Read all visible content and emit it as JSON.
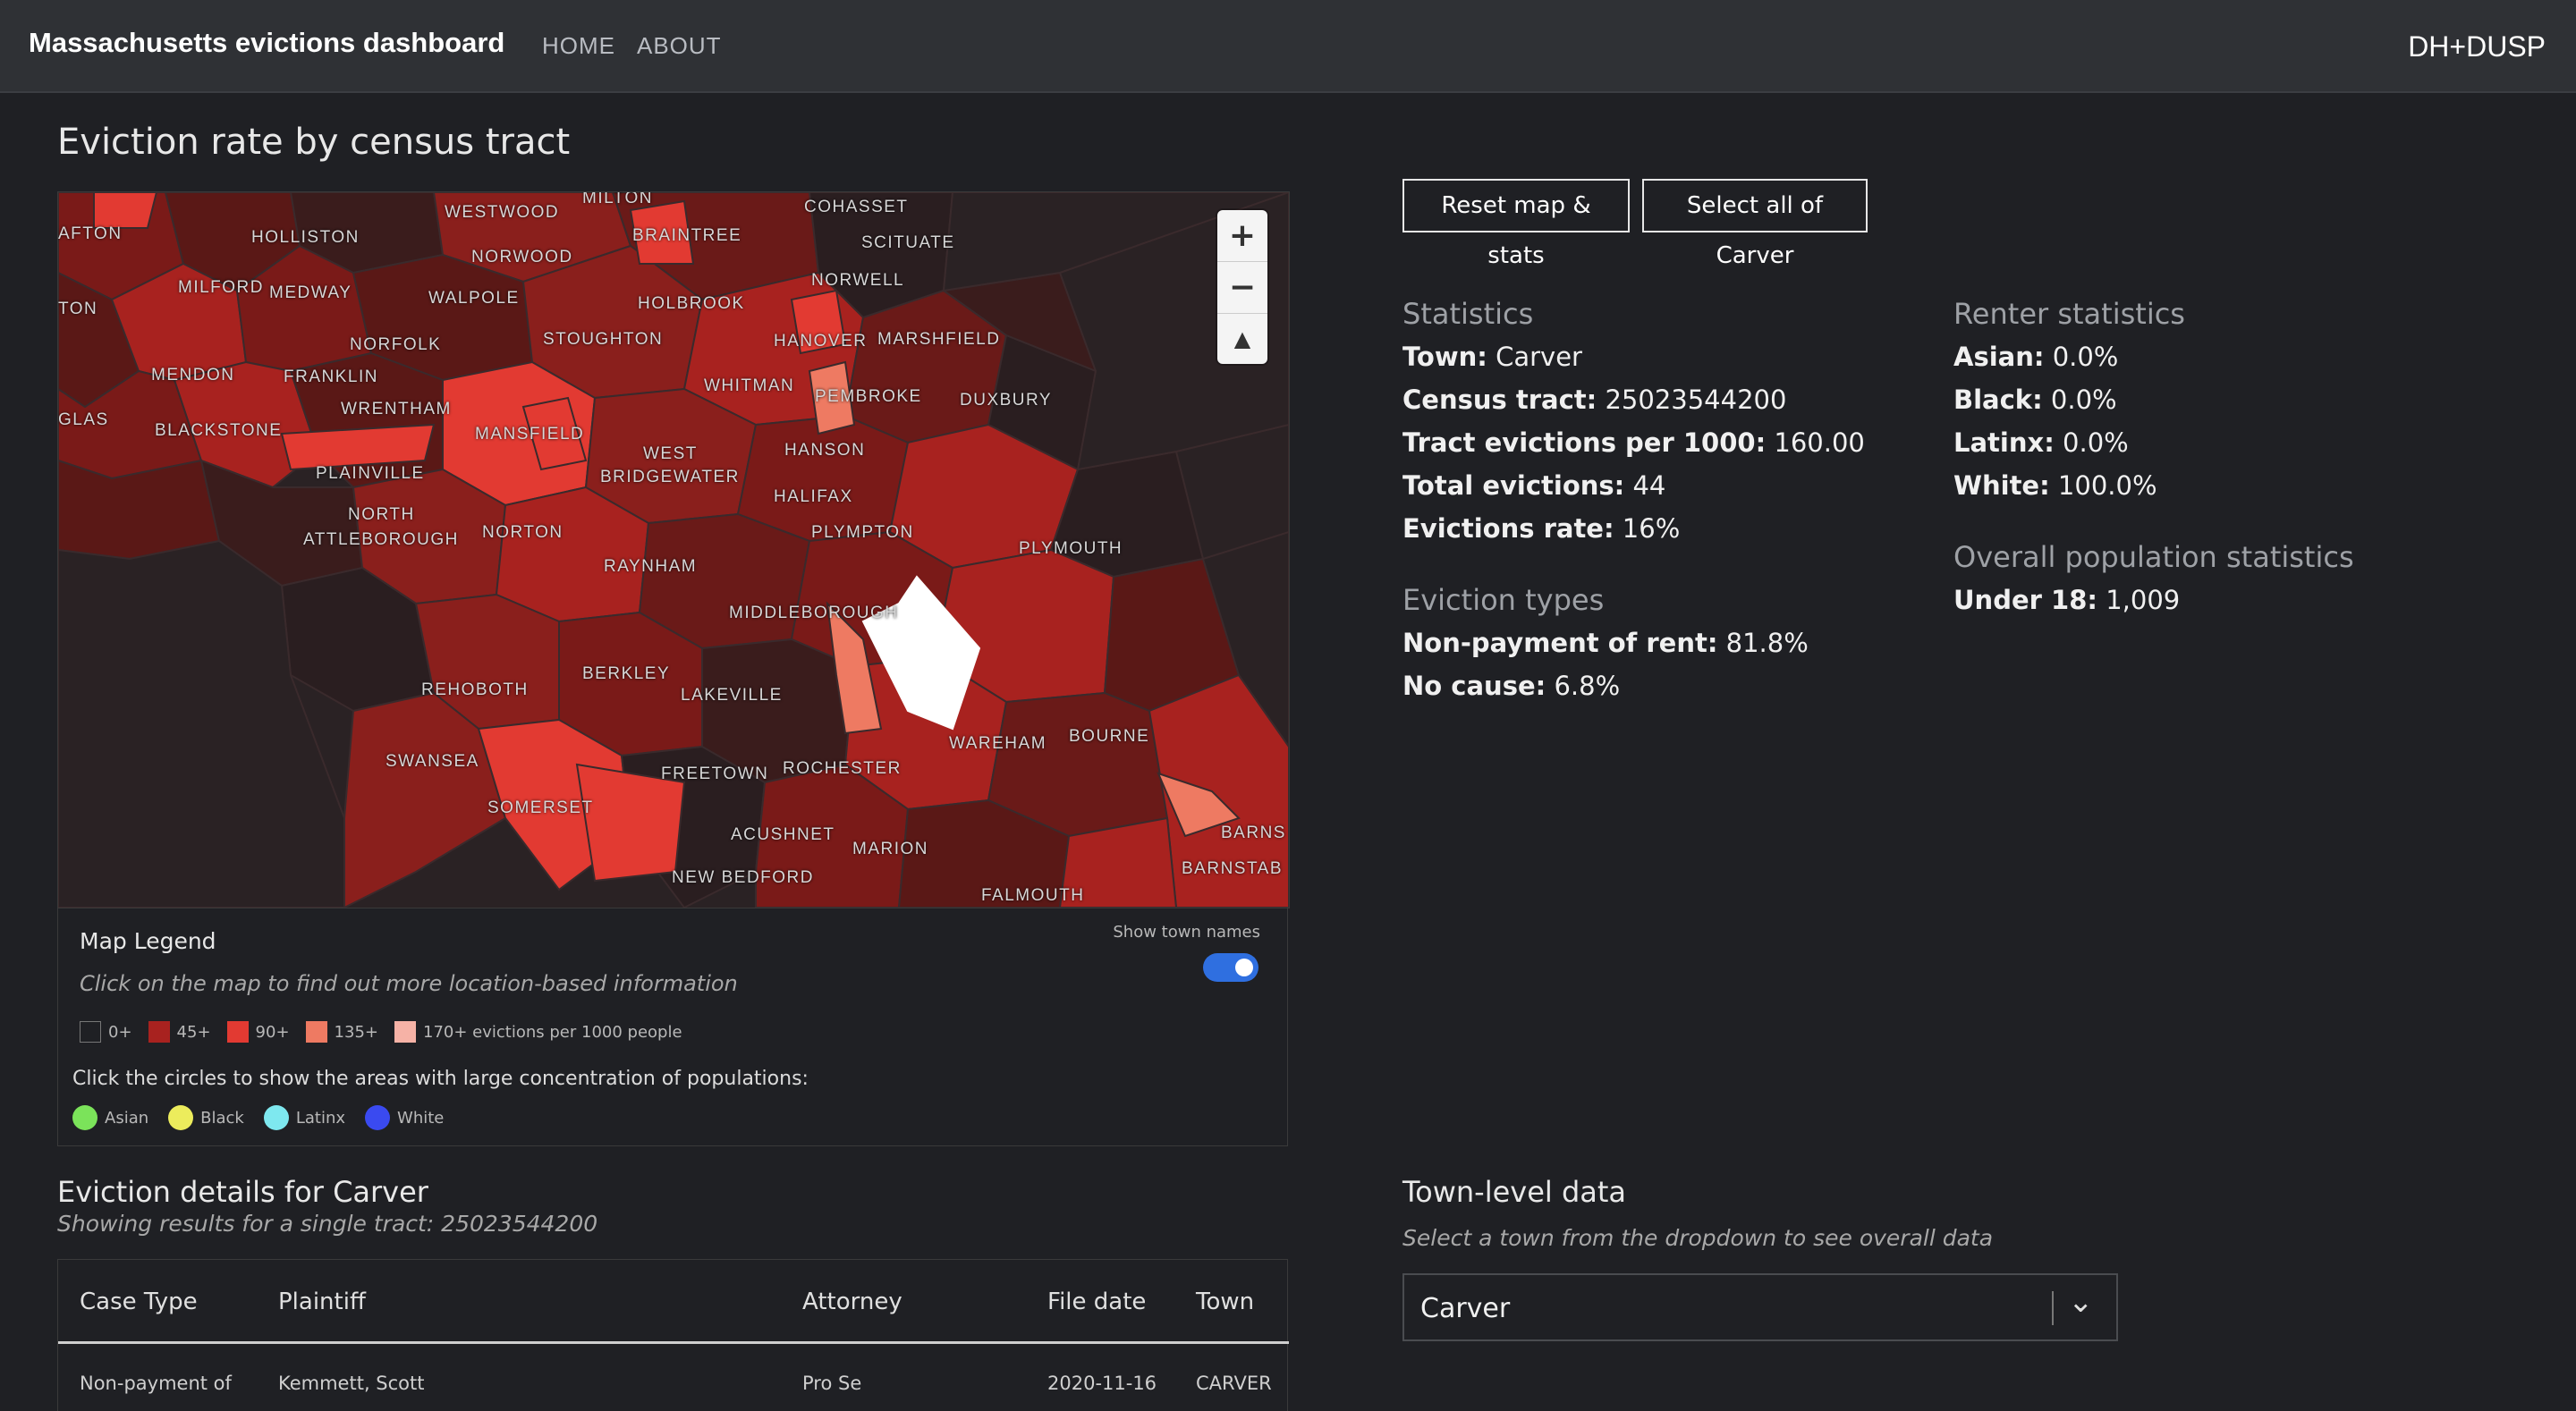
{
  "nav": {
    "brand": "Massachusetts evictions dashboard",
    "links": [
      "HOME",
      "ABOUT"
    ],
    "right": "DH+DUSP"
  },
  "map_section": {
    "title": "Eviction rate by census tract",
    "town_labels": [
      "AFTON",
      "HOLLISTON",
      "WESTWOOD",
      "MILTON",
      "COHASSET",
      "BRAINTREE",
      "SCITUATE",
      "NORWOOD",
      "MILFORD",
      "MEDWAY",
      "WALPOLE",
      "HOLBROOK",
      "NORWELL",
      "TON",
      "STOUGHTON",
      "HANOVER",
      "MARSHFIELD",
      "NORFOLK",
      "MENDON",
      "FRANKLIN",
      "WHITMAN",
      "PEMBROKE",
      "DUXBURY",
      "GLAS",
      "WRENTHAM",
      "BLACKSTONE",
      "MANSFIELD",
      "HANSON",
      "WEST",
      "BRIDGEWATER",
      "PLAINVILLE",
      "HALIFAX",
      "NORTH",
      "ATTLEBOROUGH",
      "NORTON",
      "PLYMPTON",
      "PLYMOUTH",
      "RAYNHAM",
      "MIDDLEBOROUGH",
      "REHOBOTH",
      "BERKLEY",
      "LAKEVILLE",
      "BOURNE",
      "WAREHAM",
      "SWANSEA",
      "FREETOWN",
      "ROCHESTER",
      "SOMERSET",
      "ACUSHNET",
      "MARION",
      "NEW BEDFORD",
      "FALMOUTH",
      "BARNS",
      "BARNSTAB"
    ],
    "zoom_in": "+",
    "zoom_out": "−",
    "compass": "▲"
  },
  "legend": {
    "title": "Map Legend",
    "hint": "Click on the map to find out more location-based information",
    "toggle_label": "Show town names",
    "toggle_on": true,
    "buckets": [
      {
        "label": "0+",
        "color": "#1f2024"
      },
      {
        "label": "45+",
        "color": "#a8221f"
      },
      {
        "label": "90+",
        "color": "#e23a32"
      },
      {
        "label": "135+",
        "color": "#ee7a62"
      },
      {
        "label": "170+ evictions per 1000 people",
        "color": "#f6b2a6"
      }
    ],
    "circles_title": "Click the circles to show the areas with large concentration of populations:",
    "circles": [
      {
        "label": "Asian",
        "color": "#7be35a"
      },
      {
        "label": "Black",
        "color": "#ecec5c"
      },
      {
        "label": "Latinx",
        "color": "#7ee8ef"
      },
      {
        "label": "White",
        "color": "#3a4af0"
      }
    ]
  },
  "buttons": {
    "reset": "Reset map & stats",
    "select_all": "Select all of Carver"
  },
  "statistics": {
    "heading": "Statistics",
    "rows": [
      {
        "k": "Town:",
        "v": "Carver"
      },
      {
        "k": "Census tract:",
        "v": "25023544200"
      },
      {
        "k": "Tract evictions per 1000:",
        "v": "160.00"
      },
      {
        "k": "Total evictions:",
        "v": "44"
      },
      {
        "k": "Evictions rate:",
        "v": "16%"
      }
    ]
  },
  "eviction_types": {
    "heading": "Eviction types",
    "rows": [
      {
        "k": "Non-payment of rent:",
        "v": "81.8%"
      },
      {
        "k": "No cause:",
        "v": "6.8%"
      }
    ]
  },
  "renter_stats": {
    "heading": "Renter statistics",
    "rows": [
      {
        "k": "Asian:",
        "v": "0.0%"
      },
      {
        "k": "Black:",
        "v": "0.0%"
      },
      {
        "k": "Latinx:",
        "v": "0.0%"
      },
      {
        "k": "White:",
        "v": "100.0%"
      }
    ]
  },
  "population_stats": {
    "heading": "Overall population statistics",
    "rows": [
      {
        "k": "Under 18:",
        "v": "1,009"
      }
    ]
  },
  "details": {
    "title": "Eviction details for Carver",
    "subtitle": "Showing results for a single tract: 25023544200",
    "columns": [
      "Case Type",
      "Plaintiff",
      "Attorney",
      "File date",
      "Town"
    ],
    "rows": [
      [
        "Non-payment of",
        "Kemmett, Scott",
        "Pro Se",
        "2020-11-16",
        "CARVER"
      ]
    ]
  },
  "town_data": {
    "title": "Town-level data",
    "subtitle": "Select a town from the dropdown to see overall data",
    "selected": "Carver"
  }
}
